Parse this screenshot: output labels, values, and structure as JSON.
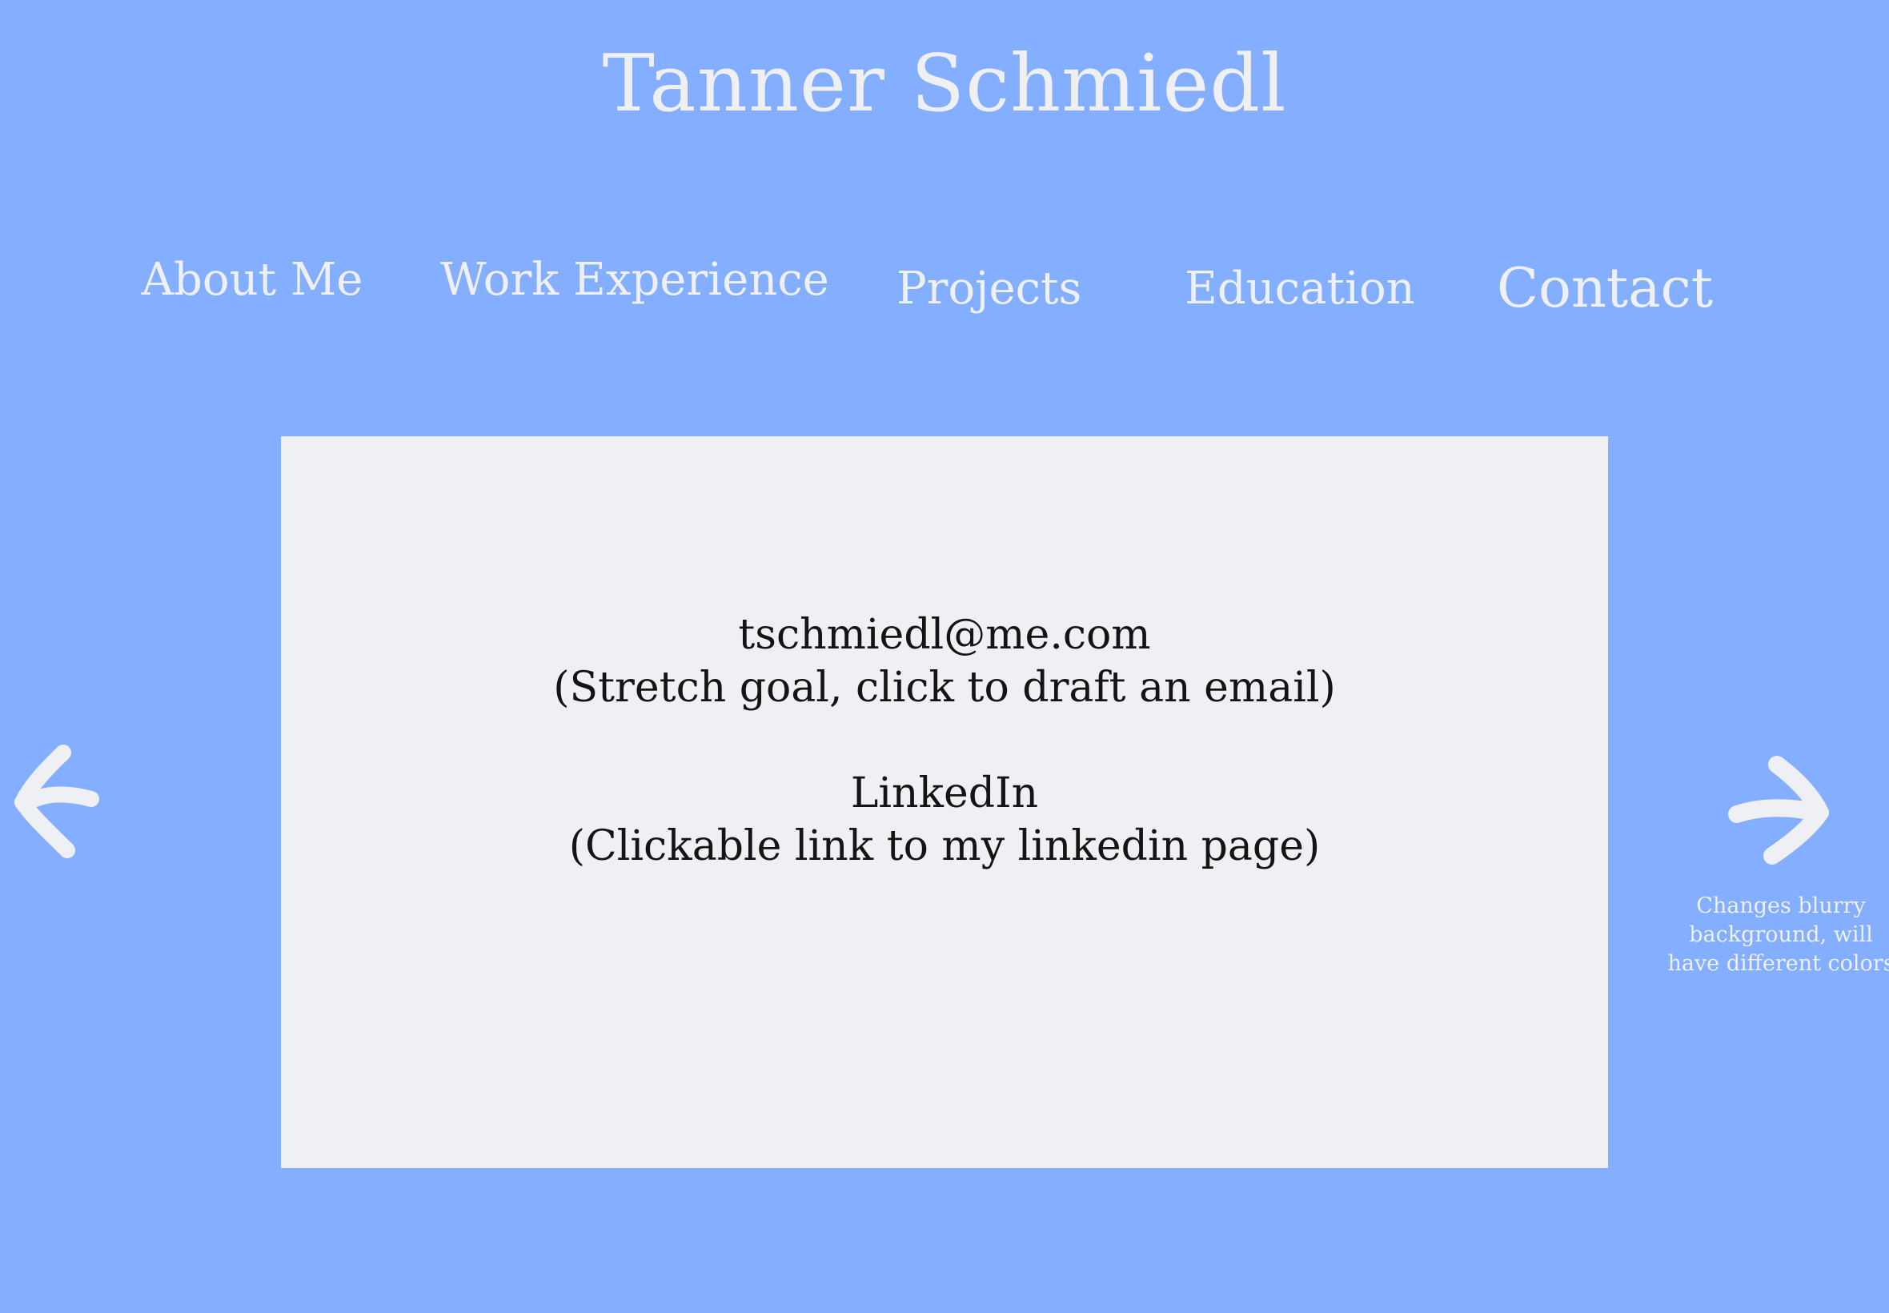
{
  "header": {
    "title": "Tanner Schmiedl"
  },
  "nav": {
    "items": [
      {
        "label": "About Me"
      },
      {
        "label": "Work Experience"
      },
      {
        "label": "Projects"
      },
      {
        "label": "Education"
      },
      {
        "label": "Contact"
      }
    ]
  },
  "card": {
    "email": "tschmiedl@me.com",
    "email_note": "(Stretch goal, click to draft an email)",
    "linkedin": "LinkedIn",
    "linkedin_note": "(Clickable link to my linkedin page)"
  },
  "arrows": {
    "left_icon": "arrow-left-icon",
    "right_icon": "arrow-right-icon",
    "color": "#eef0f4"
  },
  "side_note": {
    "line1": "Changes blurry",
    "line2": "background, will",
    "line3": "have different colors"
  },
  "colors": {
    "background": "#84aeff",
    "card": "#eff0f3",
    "light_text": "#eef0f4",
    "dark_text": "#141414"
  }
}
